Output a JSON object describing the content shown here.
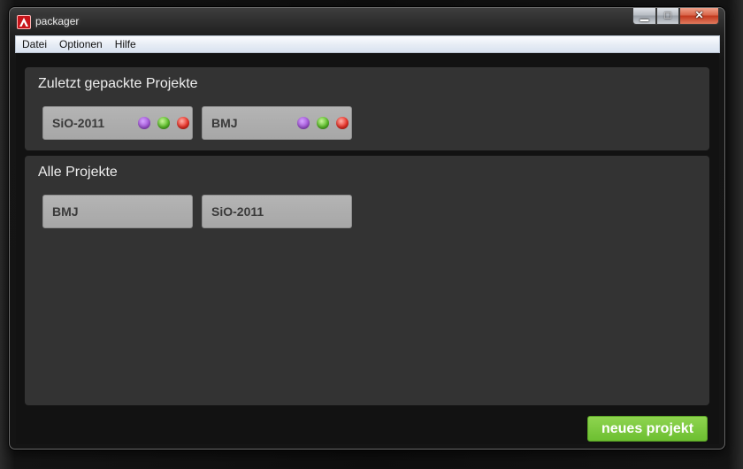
{
  "window": {
    "title": "packager",
    "controls": {
      "minimize_icon": "minimize-icon",
      "maximize_icon": "maximize-icon",
      "close_icon": "close-icon"
    }
  },
  "menubar": {
    "items": [
      {
        "label": "Datei"
      },
      {
        "label": "Optionen"
      },
      {
        "label": "Hilfe"
      }
    ]
  },
  "recent": {
    "title": "Zuletzt gepackte Projekte",
    "projects": [
      {
        "name": "SiO-2011",
        "status": [
          "purple",
          "green",
          "red"
        ]
      },
      {
        "name": "BMJ",
        "status": [
          "purple",
          "green",
          "red"
        ]
      }
    ]
  },
  "all": {
    "title": "Alle Projekte",
    "projects": [
      {
        "name": "BMJ"
      },
      {
        "name": "SiO-2011"
      }
    ]
  },
  "actions": {
    "new_project_label": "neues projekt"
  },
  "colors": {
    "accent_green": "#6dbf31",
    "panel_bg": "#333333",
    "card_bg": "#ababab",
    "status_purple": "#a55ad9",
    "status_green": "#5cbd2b",
    "status_red": "#e8342a"
  }
}
